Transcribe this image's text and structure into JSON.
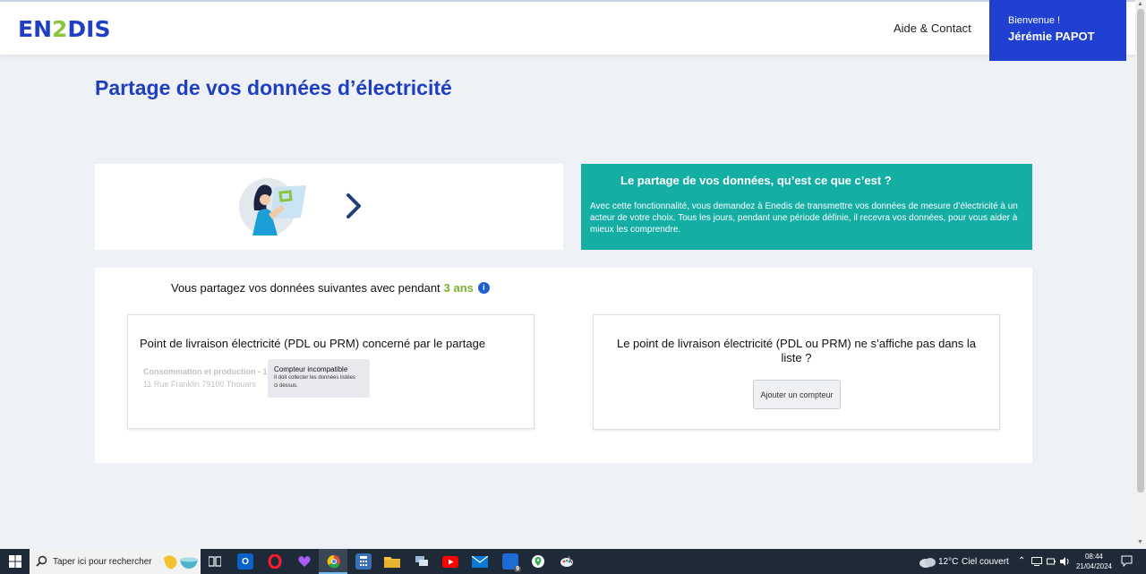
{
  "header": {
    "logo": {
      "part1": "EN",
      "part2": "2",
      "part3": "DIS"
    },
    "help_link": "Aide & Contact",
    "user": {
      "greeting": "Bienvenue !",
      "name": "Jérémie PAPOT"
    }
  },
  "page": {
    "title": "Partage de vos données d’électricité"
  },
  "info": {
    "title": "Le partage de vos données, qu’est ce que c’est ?",
    "text": "Avec cette fonctionnalité, vous demandez à Enedis de transmettre vos données de mesure d’électricité à un acteur de votre choix. Tous les jours, pendant une période définie, il recevra vos données, pour vous aider à mieux les comprendre."
  },
  "sharing": {
    "prefix": "Vous partagez vos données suivantes avec pendant",
    "duration": "3 ans",
    "info_icon": "i"
  },
  "pdl_card": {
    "title": "Point de livraison électricité (PDL ou PRM) concerné par le partage",
    "meter_type": "Consommation et production - 1¹",
    "meter_address": "11 Rue Franklin 79100 Thouars",
    "tooltip": {
      "title": "Compteur incompatible",
      "text": "Il doit collecter les données listées ci dessus."
    }
  },
  "missing_card": {
    "title": "Le point de livraison électricité (PDL ou PRM) ne s’affiche pas dans la liste ?",
    "button": "Ajouter un compteur"
  },
  "taskbar": {
    "search_placeholder": "Taper ici pour rechercher",
    "mail_badge": "9",
    "weather": {
      "temp": "12°C",
      "condition": "Ciel couvert"
    },
    "time": "08:44",
    "date": "21/04/2024"
  },
  "colors": {
    "brand_blue": "#1f40c4",
    "brand_green": "#8cc43f",
    "teal": "#14aea5",
    "duration_green": "#7ab22d"
  }
}
